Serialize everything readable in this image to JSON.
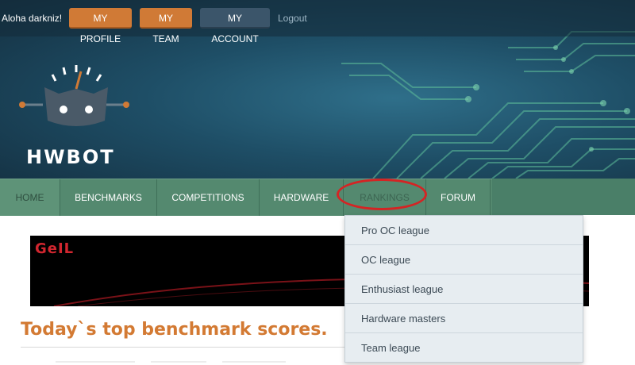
{
  "topbar": {
    "greeting": "Aloha darkniz!",
    "buttons": {
      "my_profile": "MY PROFILE",
      "my_team": "MY TEAM",
      "my_account": "MY ACCOUNT"
    },
    "logout": "Logout"
  },
  "brand": {
    "name": "HWBOT",
    "logo_icon": "hwbot-robot-icon"
  },
  "nav": {
    "items": [
      {
        "label": "HOME"
      },
      {
        "label": "BENCHMARKS"
      },
      {
        "label": "COMPETITIONS"
      },
      {
        "label": "HARDWARE"
      },
      {
        "label": "RANKINGS"
      },
      {
        "label": "FORUM"
      }
    ],
    "active": "RANKINGS"
  },
  "rankings_menu": {
    "items": [
      {
        "label": "Pro OC league"
      },
      {
        "label": "OC league"
      },
      {
        "label": "Enthusiast league"
      },
      {
        "label": "Hardware masters"
      },
      {
        "label": "Team league"
      }
    ]
  },
  "ad": {
    "brand": "GeIL"
  },
  "content": {
    "heading": "Today`s top benchmark scores."
  },
  "colors": {
    "accent_orange": "#d07a36",
    "nav_green": "#54896f",
    "highlight_red": "#d42424",
    "heading_orange": "#d37a33"
  }
}
